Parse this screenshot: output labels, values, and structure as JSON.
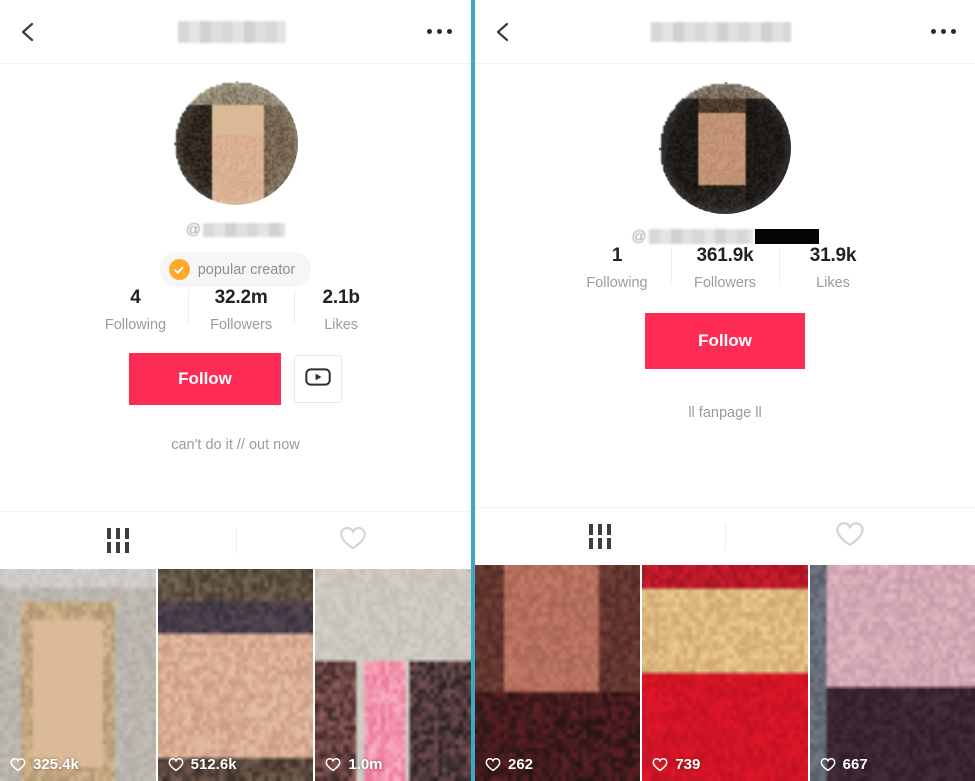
{
  "colors": {
    "accent_red": "#fe2c55",
    "divider_teal": "#3aa9c2",
    "badge_orange": "#ffa928",
    "muted_text": "#9b9b9b"
  },
  "divider": {
    "name": "panel-divider"
  },
  "panels": [
    {
      "id": "left",
      "header": {
        "back_icon": "chevron-left-icon",
        "title": "",
        "title_redacted": true,
        "menu_icon": "more-horizontal-icon"
      },
      "avatar": {
        "icon": "avatar",
        "redacted": true
      },
      "handle": {
        "at": "@",
        "value": "",
        "redacted": true,
        "black_bar": false
      },
      "badge": {
        "visible": true,
        "label": "popular creator",
        "icon": "verified-check-icon"
      },
      "stats": [
        {
          "value": "4",
          "label": "Following"
        },
        {
          "value": "32.2m",
          "label": "Followers"
        },
        {
          "value": "2.1b",
          "label": "Likes"
        }
      ],
      "actions": {
        "follow_label": "Follow",
        "has_secondary": true,
        "secondary_icon": "youtube-play-icon"
      },
      "bio": "can't do it // out now",
      "tabs": [
        {
          "icon": "grid-icon",
          "active": true
        },
        {
          "icon": "heart-icon",
          "active": false
        }
      ],
      "videos": [
        {
          "likes": "325.4k",
          "icon": "heart-icon"
        },
        {
          "likes": "512.6k",
          "icon": "heart-icon"
        },
        {
          "likes": "1.0m",
          "icon": "heart-icon"
        }
      ]
    },
    {
      "id": "right",
      "header": {
        "back_icon": "chevron-left-icon",
        "title": "",
        "title_redacted": true,
        "menu_icon": "more-horizontal-icon"
      },
      "avatar": {
        "icon": "avatar",
        "redacted": true
      },
      "handle": {
        "at": "@",
        "value": "",
        "redacted": true,
        "black_bar": true
      },
      "badge": {
        "visible": false,
        "label": "",
        "icon": ""
      },
      "stats": [
        {
          "value": "1",
          "label": "Following"
        },
        {
          "value": "361.9k",
          "label": "Followers"
        },
        {
          "value": "31.9k",
          "label": "Likes"
        }
      ],
      "actions": {
        "follow_label": "Follow",
        "has_secondary": false,
        "secondary_icon": ""
      },
      "bio": "ll fanpage ll",
      "tabs": [
        {
          "icon": "grid-icon",
          "active": true
        },
        {
          "icon": "heart-icon",
          "active": false
        }
      ],
      "videos": [
        {
          "likes": "262",
          "icon": "heart-icon"
        },
        {
          "likes": "739",
          "icon": "heart-icon"
        },
        {
          "likes": "667",
          "icon": "heart-icon"
        }
      ]
    }
  ]
}
